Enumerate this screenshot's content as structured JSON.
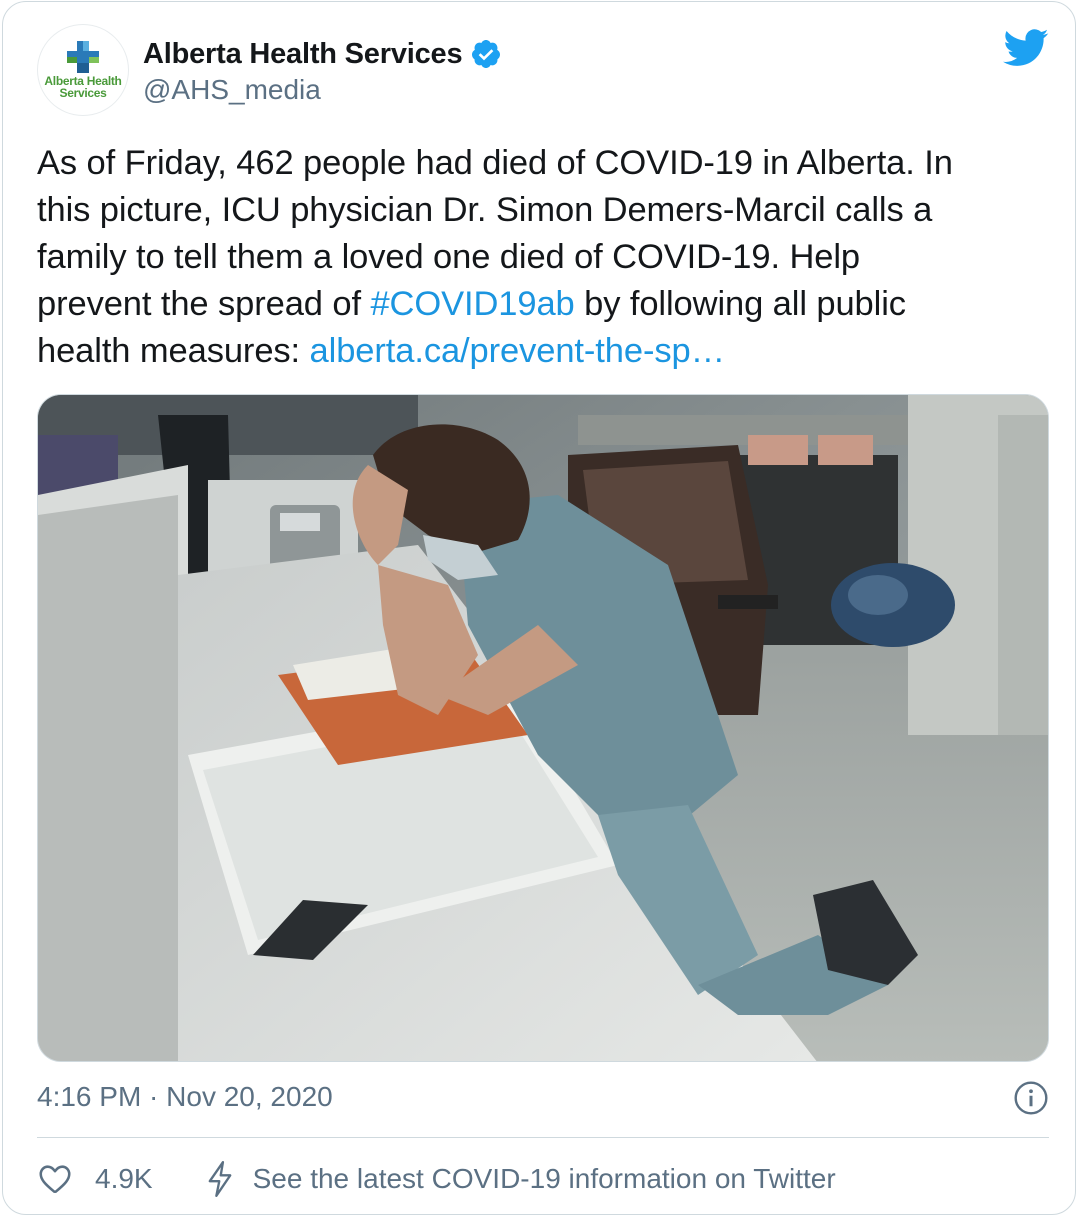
{
  "account": {
    "display_name": "Alberta Health Services",
    "handle": "@AHS_media",
    "verified": true,
    "avatar_line1": "Alberta Health",
    "avatar_line2": "Services"
  },
  "icons": {
    "verified": "verified-badge-icon",
    "brand": "twitter-bird-icon",
    "info": "info-icon",
    "like": "heart-icon",
    "covid": "lightning-bolt-icon"
  },
  "tweet": {
    "text_lines": [
      "As of Friday, 462 people had died of COVID-19 in Alberta. In",
      "this picture, ICU physician Dr. Simon Demers-Marcil calls a",
      "family to tell them a loved one died of COVID-19. Help"
    ],
    "line4_before": "prevent the spread of ",
    "hashtag": "#COVID19ab",
    "line4_after": " by following all public",
    "line5_before": "health measures: ",
    "link": "alberta.ca/prevent-the-sp…"
  },
  "meta": {
    "timestamp": "4:16 PM · Nov 20, 2020"
  },
  "actions": {
    "like_count": "4.9K",
    "covid_info": "See the latest COVID-19 information on Twitter"
  },
  "colors": {
    "link": "#1b95e0",
    "secondary_text": "#5b7083",
    "border": "#cfd9de",
    "verified": "#1da1f2"
  }
}
